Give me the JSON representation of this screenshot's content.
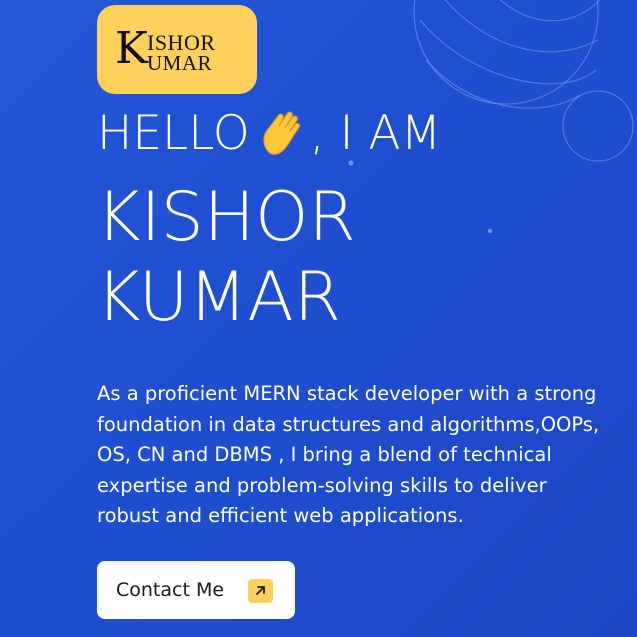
{
  "logo": {
    "initial": "K",
    "line1": "ISHOR",
    "line2": "UMAR"
  },
  "hero": {
    "greeting_before": "HELLO",
    "greeting_emoji": "waving-hand-icon",
    "greeting_after": ", I AM",
    "name_line1": "KISHOR",
    "name_line2": "KUMAR",
    "bio_lines": [
      "As a proficient MERN stack developer with a strong",
      "foundation in data structures and algorithms,OOPs,",
      "OS, CN and DBMS , I bring a blend of technical",
      "expertise and problem-solving skills to deliver",
      "robust and efficient web applications."
    ],
    "contact_label": "Contact Me",
    "contact_icon": "arrow-up-right-icon"
  },
  "colors": {
    "background": "#2253d4",
    "accent": "#fdd15c",
    "text": "#ffffff",
    "button_background": "#ffffff",
    "button_text": "#1a1a1a"
  }
}
